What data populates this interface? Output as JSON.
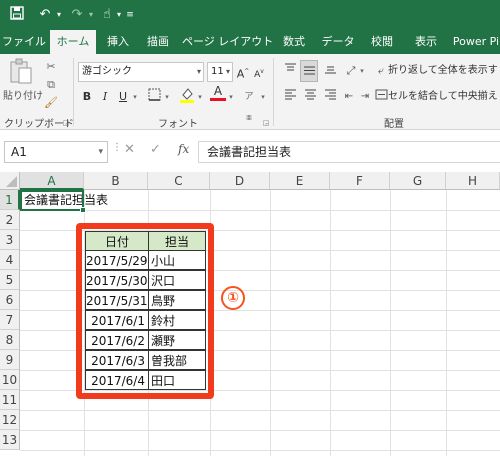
{
  "quick_access": {
    "save_icon": "save-icon",
    "undo_icon": "undo-icon",
    "redo_icon": "redo-icon",
    "touch_icon": "touch-mode-icon",
    "customize_icon": "customize-icon"
  },
  "ribbon_tabs": [
    "ファイル",
    "ホーム",
    "挿入",
    "描画",
    "ページ レイアウト",
    "数式",
    "データ",
    "校閲",
    "表示",
    "Power Pi"
  ],
  "ribbon": {
    "paste_label": "貼り付け",
    "clipboard_group": "クリップボード",
    "font_name": "游ゴシック",
    "font_size": "11",
    "font_group": "フォント",
    "bold": "B",
    "italic": "I",
    "underline": "U",
    "font_color_glyph": "A",
    "wrap_text": "折り返して全体を表示す",
    "merge_center": "セルを結合して中央揃え",
    "alignment_group": "配置"
  },
  "formula_bar": {
    "name_box": "A1",
    "fx": "fx",
    "content": "会議書記担当表"
  },
  "grid": {
    "columns": [
      "A",
      "B",
      "C",
      "D",
      "E",
      "F",
      "G",
      "H"
    ],
    "rows": [
      "1",
      "2",
      "3",
      "4",
      "5",
      "6",
      "7",
      "8",
      "9",
      "10",
      "11",
      "12",
      "13"
    ],
    "a1_text": "会議書記担当表",
    "table_headers": [
      "日付",
      "担当"
    ],
    "table_rows": [
      [
        "2017/5/29",
        "小山"
      ],
      [
        "2017/5/30",
        "沢口"
      ],
      [
        "2017/5/31",
        "鳥野"
      ],
      [
        "2017/6/1",
        "鈴村"
      ],
      [
        "2017/6/2",
        "瀬野"
      ],
      [
        "2017/6/3",
        "曽我部"
      ],
      [
        "2017/6/4",
        "田口"
      ]
    ]
  },
  "annotation": {
    "marker": "①",
    "color": "#f23a1c"
  },
  "colors": {
    "brand": "#217346",
    "header_fill": "#d5e8c8"
  }
}
